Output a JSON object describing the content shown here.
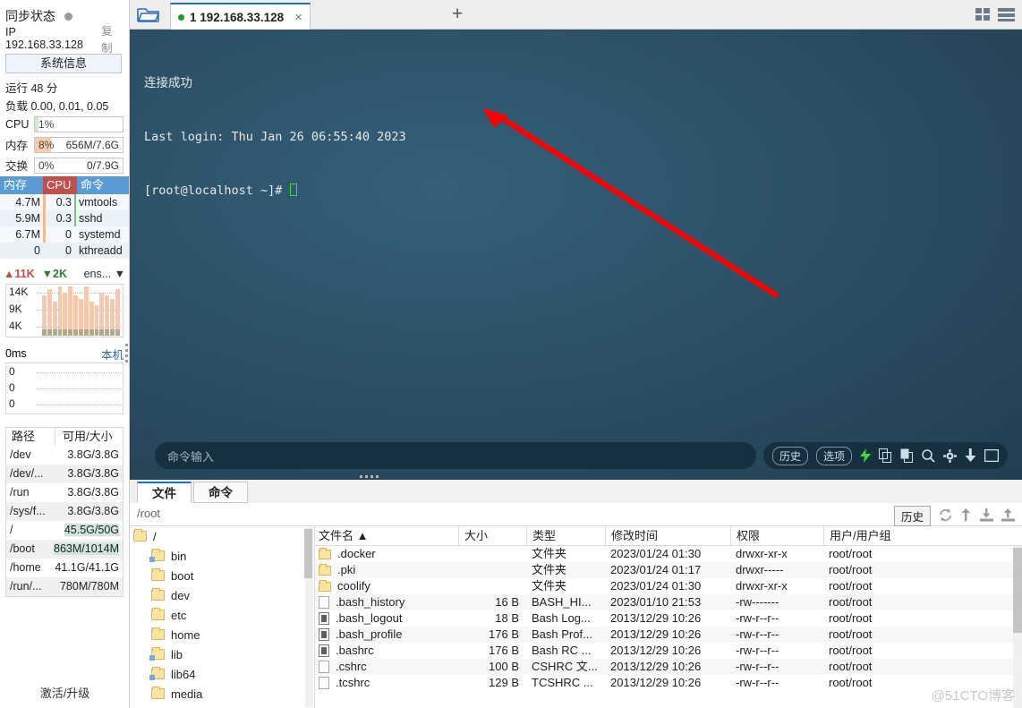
{
  "sidebar": {
    "sync_label": "同步状态",
    "ip_label": "IP 192.168.33.128",
    "copy_label": "复制",
    "sysinfo_button": "系统信息",
    "uptime": "运行 48 分",
    "load": "负载 0.00, 0.01, 0.05",
    "meters": [
      {
        "name": "CPU",
        "label": "CPU",
        "percent": "1%",
        "right": "",
        "fill": "#cfe8cf",
        "width": 4
      },
      {
        "name": "内存",
        "label": "内存",
        "percent": "8%",
        "right": "656M/7.6G",
        "fill": "#f6cda6",
        "width": 18
      },
      {
        "name": "交换",
        "label": "交换",
        "percent": "0%",
        "right": "0/7.9G",
        "fill": "#e8e8e8",
        "width": 0
      }
    ],
    "proc_headers": {
      "mem": "内存",
      "cpu": "CPU",
      "cmd": "命令"
    },
    "processes": [
      {
        "mem": "4.7M",
        "cpu": "0.3",
        "cmd": "vmtools"
      },
      {
        "mem": "5.9M",
        "cpu": "0.3",
        "cmd": "sshd"
      },
      {
        "mem": "6.7M",
        "cpu": "0",
        "cmd": "systemd"
      },
      {
        "mem": "0",
        "cpu": "0",
        "cmd": "kthreadd"
      }
    ],
    "net": {
      "up": "11K",
      "down": "2K",
      "nic": "ens...",
      "y_labels": [
        "14K",
        "9K",
        "4K"
      ]
    },
    "latency": {
      "value": "0ms",
      "right_label": "本机",
      "y_labels": [
        "0",
        "0",
        "0"
      ]
    },
    "disk_headers": {
      "path": "路径",
      "size": "可用/大小"
    },
    "disks": [
      {
        "path": "/dev",
        "size": "3.8G/3.8G",
        "hl": false
      },
      {
        "path": "/dev/...",
        "size": "3.8G/3.8G",
        "hl": false
      },
      {
        "path": "/run",
        "size": "3.8G/3.8G",
        "hl": false
      },
      {
        "path": "/sys/f...",
        "size": "3.8G/3.8G",
        "hl": false
      },
      {
        "path": "/",
        "size": "45.5G/50G",
        "hl": true
      },
      {
        "path": "/boot",
        "size": "863M/1014M",
        "hl": true
      },
      {
        "path": "/home",
        "size": "41.1G/41.1G",
        "hl": false
      },
      {
        "path": "/run/...",
        "size": "780M/780M",
        "hl": false
      }
    ],
    "activate": "激活/升级"
  },
  "tabbar": {
    "folder_icon": "folder-open-icon",
    "tab_label": "1 192.168.33.128",
    "close_label": "×",
    "plus_label": "+"
  },
  "terminal": {
    "line1": "连接成功",
    "line2": "Last login: Thu Jan 26 06:55:40 2023",
    "line3": "[root@localhost ~]# ",
    "input_placeholder": "命令输入",
    "history_button": "历史",
    "options_button": "选项",
    "icons": [
      "lightning-icon",
      "copy-icon",
      "paste-icon",
      "search-icon",
      "gear-icon",
      "download-icon",
      "window-icon"
    ]
  },
  "filemanager": {
    "tabs": [
      {
        "label": "文件",
        "active": true
      },
      {
        "label": "命令",
        "active": false
      }
    ],
    "path": "/root",
    "history_button": "历史",
    "tool_icons": [
      "refresh-icon",
      "upload-icon",
      "download-file-icon",
      "upload-file-icon"
    ],
    "tree": [
      {
        "label": "/",
        "root": true,
        "link": false
      },
      {
        "label": "bin",
        "root": false,
        "link": true
      },
      {
        "label": "boot",
        "root": false,
        "link": false
      },
      {
        "label": "dev",
        "root": false,
        "link": false
      },
      {
        "label": "etc",
        "root": false,
        "link": false
      },
      {
        "label": "home",
        "root": false,
        "link": false
      },
      {
        "label": "lib",
        "root": false,
        "link": true
      },
      {
        "label": "lib64",
        "root": false,
        "link": true
      },
      {
        "label": "media",
        "root": false,
        "link": false
      }
    ],
    "columns": [
      "文件名",
      "大小",
      "类型",
      "修改时间",
      "权限",
      "用户/用户组"
    ],
    "sort_indicator": "▲",
    "rows": [
      {
        "icon": "folder",
        "name": ".docker",
        "size": "",
        "type": "文件夹",
        "time": "2023/01/24 01:30",
        "perm": "drwxr-xr-x",
        "user": "root/root"
      },
      {
        "icon": "folder",
        "name": ".pki",
        "size": "",
        "type": "文件夹",
        "time": "2023/01/24 01:17",
        "perm": "drwxr-----",
        "user": "root/root"
      },
      {
        "icon": "folder",
        "name": "coolify",
        "size": "",
        "type": "文件夹",
        "time": "2023/01/24 01:30",
        "perm": "drwxr-xr-x",
        "user": "root/root"
      },
      {
        "icon": "file",
        "name": ".bash_history",
        "size": "16 B",
        "type": "BASH_HI...",
        "time": "2023/01/10 21:53",
        "perm": "-rw-------",
        "user": "root/root"
      },
      {
        "icon": "doc",
        "name": ".bash_logout",
        "size": "18 B",
        "type": "Bash Log...",
        "time": "2013/12/29 10:26",
        "perm": "-rw-r--r--",
        "user": "root/root"
      },
      {
        "icon": "doc",
        "name": ".bash_profile",
        "size": "176 B",
        "type": "Bash Prof...",
        "time": "2013/12/29 10:26",
        "perm": "-rw-r--r--",
        "user": "root/root"
      },
      {
        "icon": "doc",
        "name": ".bashrc",
        "size": "176 B",
        "type": "Bash RC ...",
        "time": "2013/12/29 10:26",
        "perm": "-rw-r--r--",
        "user": "root/root"
      },
      {
        "icon": "file",
        "name": ".cshrc",
        "size": "100 B",
        "type": "CSHRC 文...",
        "time": "2013/12/29 10:26",
        "perm": "-rw-r--r--",
        "user": "root/root"
      },
      {
        "icon": "file",
        "name": ".tcshrc",
        "size": "129 B",
        "type": "TCSHRC ...",
        "time": "2013/12/29 10:26",
        "perm": "-rw-r--r--",
        "user": "root/root"
      }
    ],
    "watermark": "@51CTO博客"
  },
  "chart_data": [
    {
      "type": "bar",
      "title": "network-traffic",
      "ylabel": "",
      "tick_labels": [
        "14K",
        "9K",
        "4K"
      ],
      "series": [
        {
          "name": "upload",
          "values": [
            11,
            13,
            9,
            14,
            12,
            14,
            11,
            10,
            14,
            9,
            8,
            12,
            11,
            10,
            13
          ]
        },
        {
          "name": "download",
          "values": [
            2,
            2,
            2,
            2,
            2,
            2,
            2,
            2,
            2,
            2,
            2,
            2,
            2,
            2,
            2
          ]
        }
      ]
    },
    {
      "type": "line",
      "title": "latency",
      "tick_labels": [
        "0",
        "0",
        "0"
      ],
      "values": [
        0,
        0,
        0,
        0,
        0,
        0,
        0,
        0,
        0,
        0
      ]
    }
  ],
  "colors": {
    "accent": "#1a73c8",
    "terminal_bg": "#2b5166",
    "arrow": "#ff0000",
    "cpu_header": "#c0504d",
    "mem_header": "#5b9bd5"
  }
}
